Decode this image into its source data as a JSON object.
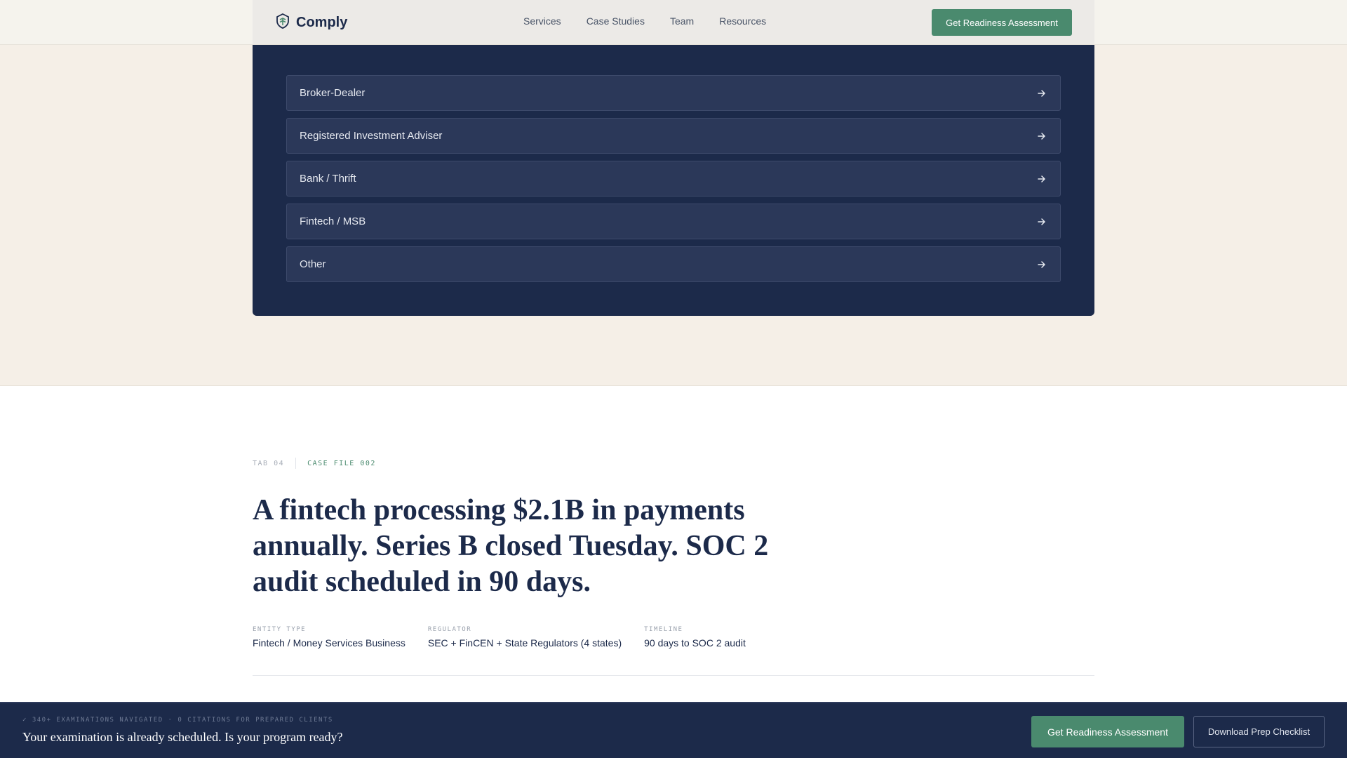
{
  "header": {
    "brand": "Comply",
    "nav": [
      "Services",
      "Case Studies",
      "Team",
      "Resources"
    ],
    "cta": "Get Readiness Assessment"
  },
  "options": [
    {
      "label": "Broker-Dealer",
      "icon": "arrow-right-icon"
    },
    {
      "label": "Registered Investment Adviser",
      "icon": "arrow-right-icon"
    },
    {
      "label": "Bank / Thrift",
      "icon": "arrow-right-icon"
    },
    {
      "label": "Fintech / MSB",
      "icon": "arrow-right-icon"
    },
    {
      "label": "Other",
      "icon": "arrow-right-icon"
    }
  ],
  "case": {
    "tab": "TAB 04",
    "file": "CASE FILE 002",
    "headline": "A fintech processing $2.1B in payments annually. Series B closed Tuesday. SOC 2 audit scheduled in 90 days.",
    "facts": [
      {
        "label": "ENTITY TYPE",
        "value": "Fintech / Money Services Business"
      },
      {
        "label": "REGULATOR",
        "value": "SEC + FinCEN + State Regulators (4 states)"
      },
      {
        "label": "TIMELINE",
        "value": "90 days to SOC 2 audit"
      }
    ]
  },
  "sticky": {
    "kicker": "✓ 340+ EXAMINATIONS NAVIGATED · 0 CITATIONS FOR PREPARED CLIENTS",
    "title": "Your examination is already scheduled. Is your program ready?",
    "primary": "Get Readiness Assessment",
    "secondary": "Download Prep Checklist"
  },
  "colors": {
    "navy": "#1c2a4a",
    "green": "#4a8a6e",
    "beige": "#f5efe7"
  }
}
